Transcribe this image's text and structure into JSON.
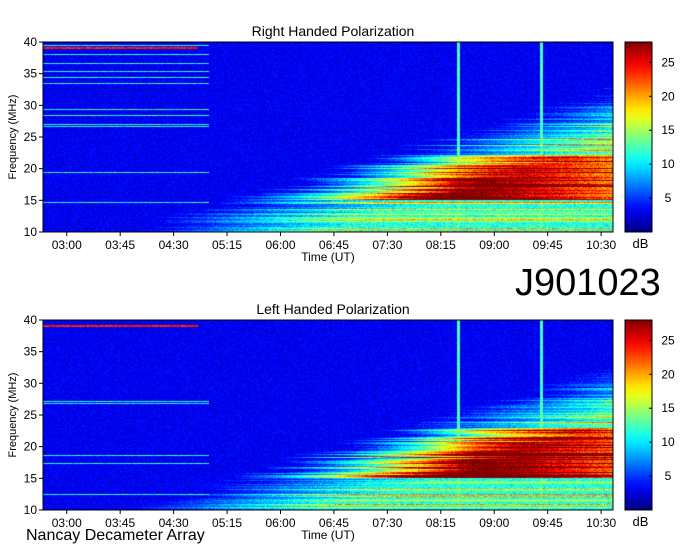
{
  "figure": {
    "observation_id": "J901023",
    "instrument": "Nancay Decameter Array"
  },
  "chart_data": [
    {
      "type": "heatmap",
      "title": "Right Handed Polarization",
      "xlabel": "Time (UT)",
      "ylabel": "Frequency (MHz)",
      "colorbar_label": "dB",
      "xticks": [
        "03:00",
        "03:45",
        "04:30",
        "05:15",
        "06:00",
        "06:45",
        "07:30",
        "08:15",
        "09:00",
        "09:45",
        "10:30"
      ],
      "xlim": [
        "02:40",
        "10:40"
      ],
      "yticks": [
        10,
        15,
        20,
        25,
        30,
        35,
        40
      ],
      "ylim": [
        10,
        40
      ],
      "colorbar_ticks": [
        5,
        10,
        15,
        20,
        25
      ],
      "colorbar_range": [
        0,
        28
      ],
      "colormap": "jet",
      "features": {
        "emission_onset_time": "05:00",
        "strong_band_mhz": [
          15,
          22
        ],
        "strong_band_peak_time": "08:30",
        "max_frequency_reached_mhz": 38,
        "vertical_artifacts": [
          "08:30",
          "09:40"
        ]
      }
    },
    {
      "type": "heatmap",
      "title": "Left Handed Polarization",
      "xlabel": "Time (UT)",
      "ylabel": "Frequency (MHz)",
      "colorbar_label": "dB",
      "xticks": [
        "03:00",
        "03:45",
        "04:30",
        "05:15",
        "06:00",
        "06:45",
        "07:30",
        "08:15",
        "09:00",
        "09:45",
        "10:30"
      ],
      "xlim": [
        "02:40",
        "10:40"
      ],
      "yticks": [
        10,
        15,
        20,
        25,
        30,
        35,
        40
      ],
      "ylim": [
        10,
        40
      ],
      "colorbar_ticks": [
        5,
        10,
        15,
        20,
        25
      ],
      "colorbar_range": [
        0,
        28
      ],
      "colormap": "jet",
      "features": {
        "emission_onset_time": "05:00",
        "strong_band_mhz": [
          15,
          23
        ],
        "strong_band_peak_time": "08:45",
        "max_frequency_reached_mhz": 38,
        "vertical_artifacts": [
          "08:30",
          "09:40"
        ]
      }
    }
  ]
}
